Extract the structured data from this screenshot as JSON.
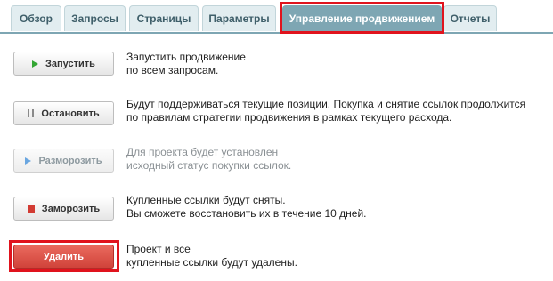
{
  "tabs": [
    {
      "label": "Обзор",
      "active": false
    },
    {
      "label": "Запросы",
      "active": false
    },
    {
      "label": "Страницы",
      "active": false
    },
    {
      "label": "Параметры",
      "active": false
    },
    {
      "label": "Управление продвижением",
      "active": true
    },
    {
      "label": "Отчеты",
      "active": false
    }
  ],
  "actions": {
    "start": {
      "label": "Запустить",
      "icon": "play-icon",
      "desc_lines": [
        "Запустить продвижение",
        "по всем запросам."
      ]
    },
    "stop": {
      "label": "Остановить",
      "icon": "pause-icon",
      "desc_lines": [
        "Будут поддерживаться текущие позиции. Покупка и снятие ссылок продолжится",
        "по правилам стратегии продвижения в рамках текущего расхода."
      ]
    },
    "unfreeze": {
      "label": "Разморозить",
      "icon": "play-icon",
      "disabled": true,
      "desc_lines": [
        "Для проекта будет установлен",
        "исходный статус покупки ссылок."
      ]
    },
    "freeze": {
      "label": "Заморозить",
      "icon": "stop-icon",
      "desc_lines": [
        "Купленные ссылки будут сняты.",
        "Вы сможете восстановить их в течение 10 дней."
      ]
    },
    "delete": {
      "label": "Удалить",
      "desc_lines": [
        "Проект и все",
        "купленные ссылки будут удалены."
      ]
    }
  },
  "colors": {
    "tab_active_bg": "#7ea6b3",
    "tab_bg": "#e2edf0",
    "highlight_frame": "#e0131d",
    "delete_button": "#d94e44",
    "play_green": "#33a633",
    "play_blue": "#6aa6e0",
    "stop_red": "#d23b33"
  }
}
